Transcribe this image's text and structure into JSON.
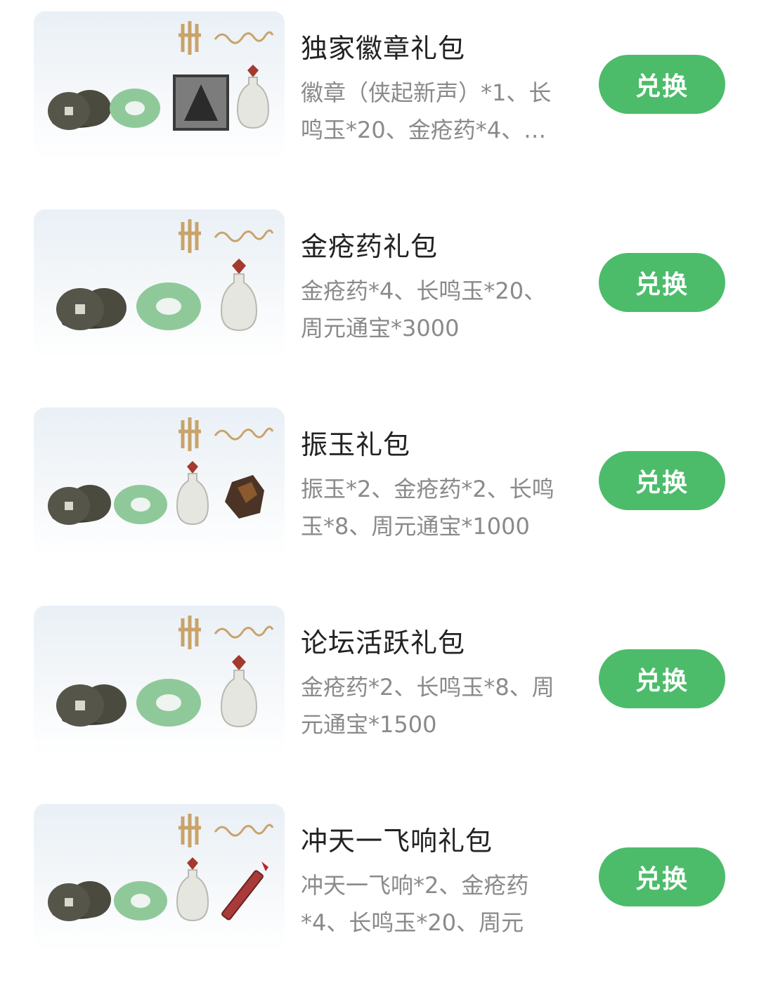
{
  "accent_color": "#4cbc6a",
  "packages": [
    {
      "name": "独家徽章礼包",
      "items": "徽章（侠起新声）*1、长\n鸣玉*20、金疮药*4、…",
      "button": "兑换",
      "thumb": [
        "coins",
        "jade",
        "badge",
        "vase"
      ]
    },
    {
      "name": "金疮药礼包",
      "items": "金疮药*4、长鸣玉*20、\n周元通宝*3000",
      "button": "兑换",
      "thumb": [
        "coins",
        "jade",
        "vase"
      ]
    },
    {
      "name": "振玉礼包",
      "items": "振玉*2、金疮药*2、长鸣\n玉*8、周元通宝*1000",
      "button": "兑换",
      "thumb": [
        "coins",
        "jade",
        "vase",
        "ore"
      ]
    },
    {
      "name": "论坛活跃礼包",
      "items": "金疮药*2、长鸣玉*8、周\n元通宝*1500",
      "button": "兑换",
      "thumb": [
        "coins",
        "jade",
        "vase"
      ]
    },
    {
      "name": "冲天一飞响礼包",
      "items": "冲天一飞响*2、金疮药\n*4、长鸣玉*20、周元",
      "button": "兑换",
      "thumb": [
        "coins",
        "jade",
        "vase",
        "firework"
      ]
    }
  ]
}
